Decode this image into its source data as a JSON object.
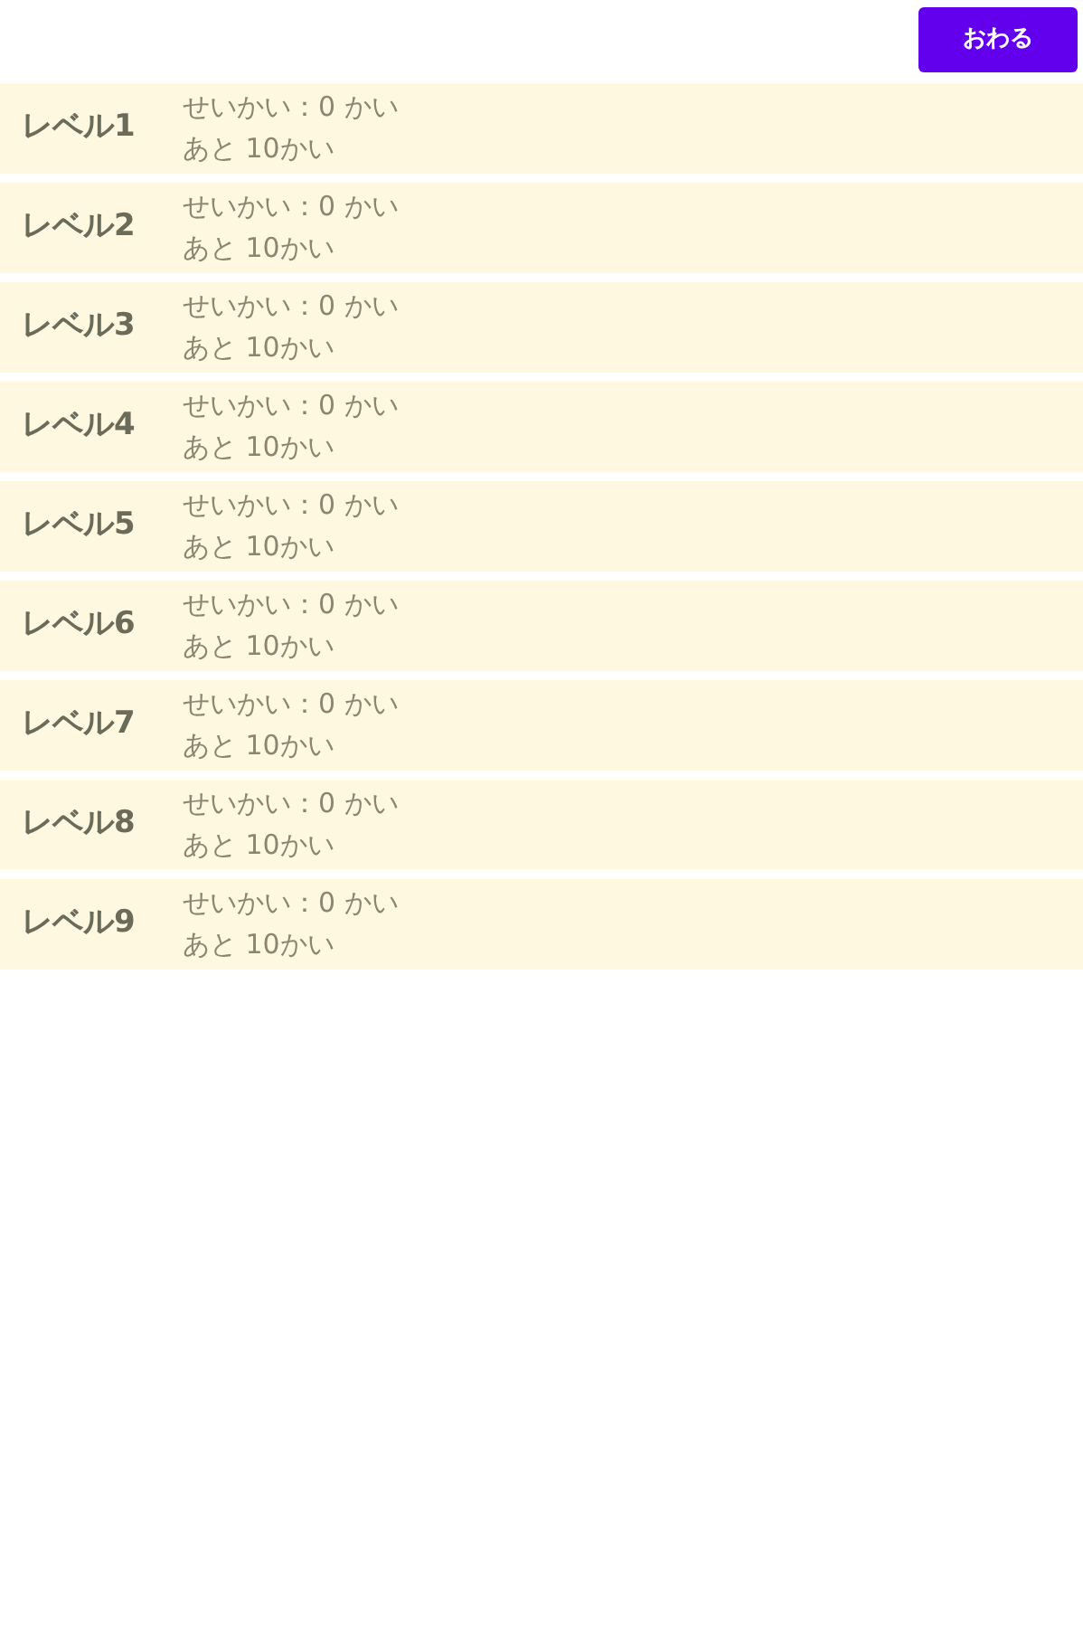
{
  "finish_button": "おわる",
  "levels": [
    {
      "name": "レベル1",
      "correct": "せいかい：0 かい",
      "remaining": "あと 10かい"
    },
    {
      "name": "レベル2",
      "correct": "せいかい：0 かい",
      "remaining": "あと 10かい"
    },
    {
      "name": "レベル3",
      "correct": "せいかい：0 かい",
      "remaining": "あと 10かい"
    },
    {
      "name": "レベル4",
      "correct": "せいかい：0 かい",
      "remaining": "あと 10かい"
    },
    {
      "name": "レベル5",
      "correct": "せいかい：0 かい",
      "remaining": "あと 10かい"
    },
    {
      "name": "レベル6",
      "correct": "せいかい：0 かい",
      "remaining": "あと 10かい"
    },
    {
      "name": "レベル7",
      "correct": "せいかい：0 かい",
      "remaining": "あと 10かい"
    },
    {
      "name": "レベル8",
      "correct": "せいかい：0 かい",
      "remaining": "あと 10かい"
    },
    {
      "name": "レベル9",
      "correct": "せいかい：0 かい",
      "remaining": "あと 10かい"
    }
  ]
}
